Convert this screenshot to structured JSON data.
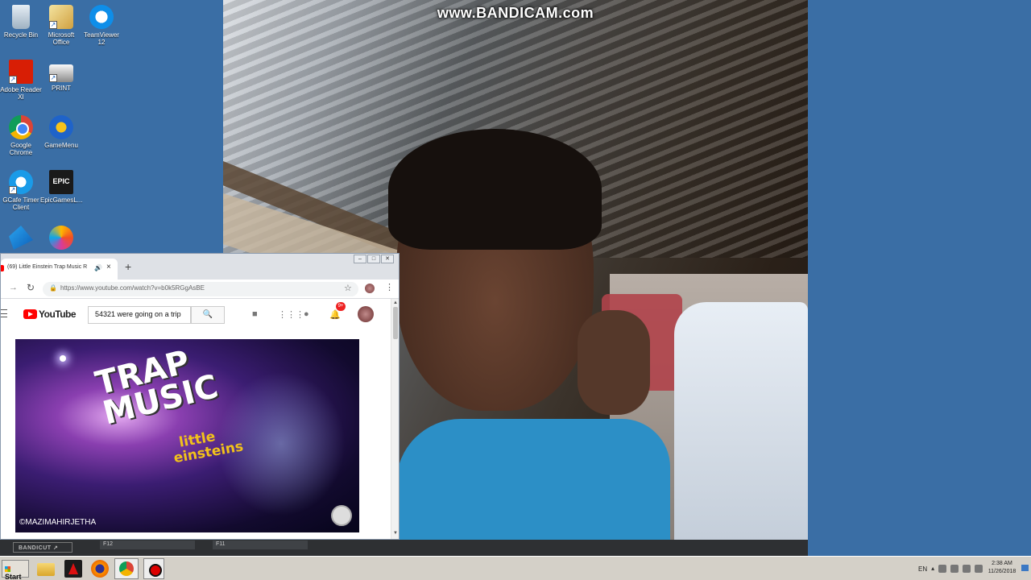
{
  "desktop": {
    "icons": [
      {
        "label": "Recycle Bin",
        "glyph": "recycle-bin-icon"
      },
      {
        "label": "Microsoft Office",
        "glyph": "office-icon"
      },
      {
        "label": "TeamViewer 12",
        "glyph": "teamviewer-icon"
      },
      {
        "label": "Adobe Reader XI",
        "glyph": "adobe-reader-icon"
      },
      {
        "label": "PRINT",
        "glyph": "printer-icon"
      },
      {
        "label": "Google Chrome",
        "glyph": "chrome-icon"
      },
      {
        "label": "GameMenu",
        "glyph": "gamemenu-icon"
      },
      {
        "label": "GCafe Timer Client",
        "glyph": "gcafe-icon"
      },
      {
        "label": "EpicGamesL...",
        "glyph": "epic-games-icon",
        "badge": "EPIC"
      },
      {
        "label": "",
        "glyph": "kite-app-icon"
      },
      {
        "label": "",
        "glyph": "edge-icon"
      }
    ]
  },
  "camera": {
    "watermark": "www.BANDICAM.com"
  },
  "browser": {
    "tab_title": "(69) Little Einstein Trap Music R",
    "url": "https://www.youtube.com/watch?v=b0k5RGgAsBE",
    "youtube": {
      "logo_text": "YouTube",
      "search_value": "54321 were going on a trip",
      "notification_count": "9+"
    },
    "video": {
      "title_line1": "TRAP",
      "title_line2": "MUSIC",
      "subtitle_line1": "little",
      "subtitle_line2": "einsteins",
      "credit": "©MAZIMAHIRJETHA"
    }
  },
  "bandicut": {
    "logo": "BANDICUT ↗",
    "keys": [
      "F12",
      "F11"
    ]
  },
  "taskbar": {
    "start_label": "Start",
    "language": "EN",
    "time": "2:38 AM",
    "date": "11/26/2018"
  },
  "colors": {
    "desktop": "#3a6ea5",
    "youtube_red": "#ff0000",
    "taskbar": "#d4d0c8"
  }
}
